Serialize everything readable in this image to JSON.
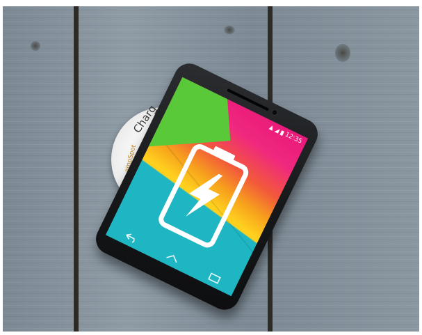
{
  "charger": {
    "label": "Charg",
    "brand": "ampSpot"
  },
  "phone": {
    "status_bar": {
      "time": "12:35"
    },
    "screen_icon": "battery-charging-icon",
    "nav_icons": [
      "back-icon",
      "home-icon",
      "recents-icon"
    ]
  },
  "colors": {
    "wood": "#8a97a1",
    "screen_teal": "#1fb6c4",
    "screen_yellow": "#ffd01e",
    "screen_pink": "#e8197a",
    "screen_green": "#59c93a",
    "charger_brand": "#c8882a"
  }
}
